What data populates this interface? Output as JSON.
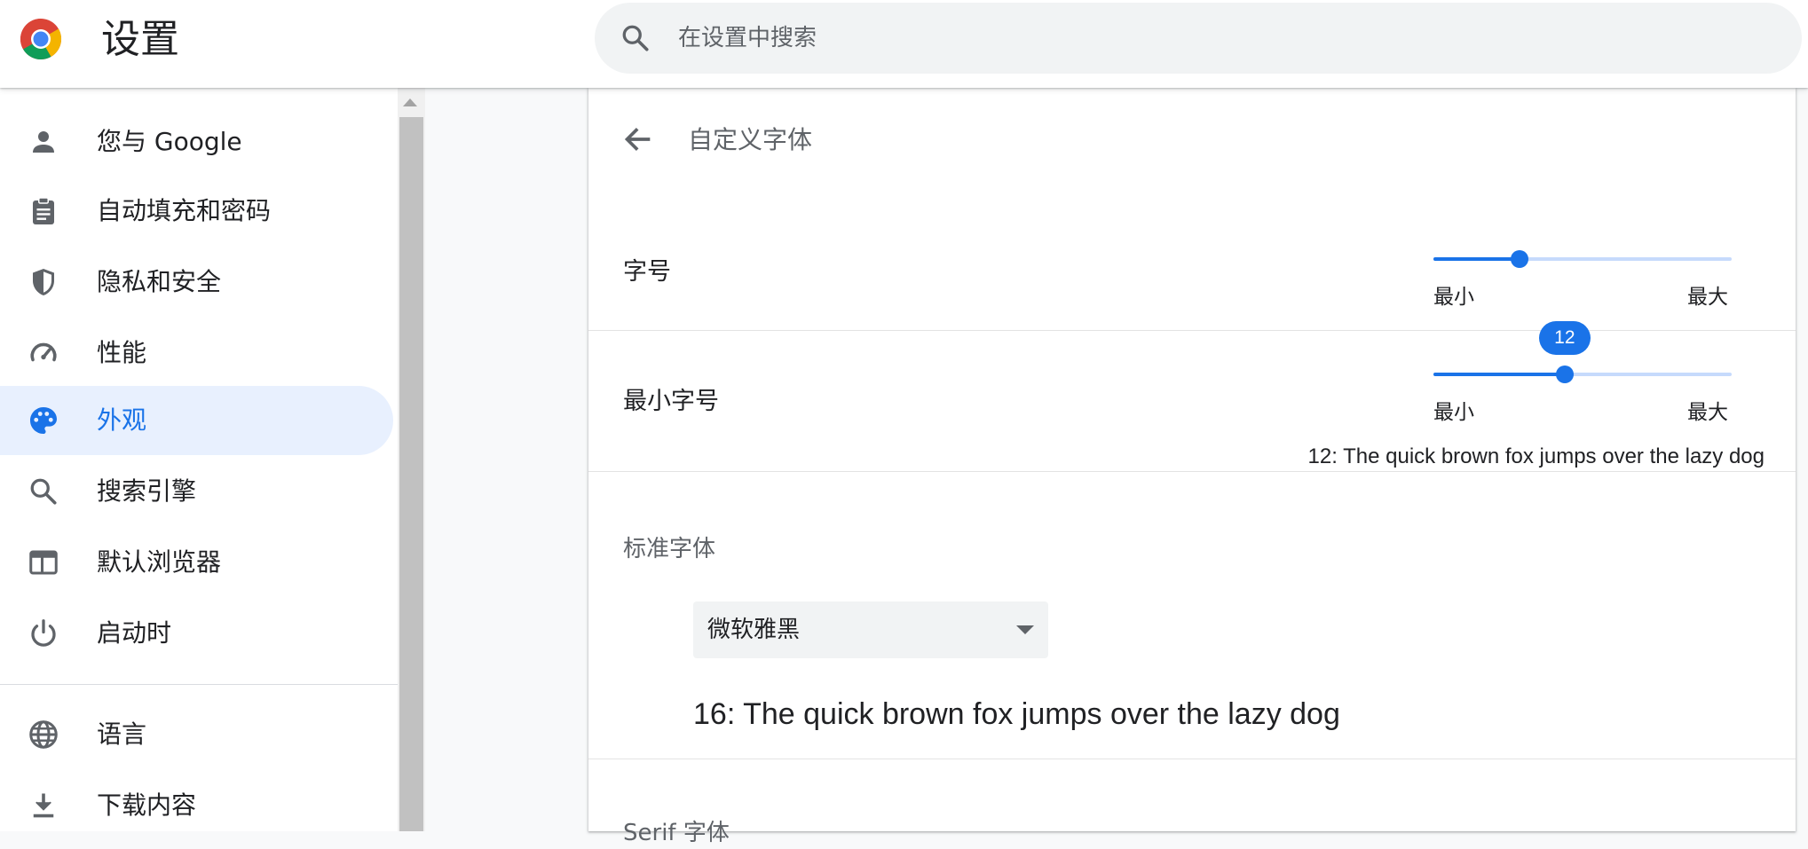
{
  "header": {
    "app_title": "设置",
    "search_placeholder": "在设置中搜索",
    "logo_icon": "chrome-logo",
    "search_icon": "search-icon"
  },
  "sidebar": {
    "items": [
      {
        "label": "您与 Google",
        "icon": "person-icon",
        "active": false
      },
      {
        "label": "自动填充和密码",
        "icon": "clipboard-icon",
        "active": false
      },
      {
        "label": "隐私和安全",
        "icon": "shield-icon",
        "active": false
      },
      {
        "label": "性能",
        "icon": "speedometer-icon",
        "active": false
      },
      {
        "label": "外观",
        "icon": "palette-icon",
        "active": true
      },
      {
        "label": "搜索引擎",
        "icon": "search-icon",
        "active": false
      },
      {
        "label": "默认浏览器",
        "icon": "browser-window-icon",
        "active": false
      },
      {
        "label": "启动时",
        "icon": "power-icon",
        "active": false
      },
      {
        "label": "语言",
        "icon": "globe-icon",
        "active": false
      },
      {
        "label": "下载内容",
        "icon": "download-icon",
        "active": false
      }
    ]
  },
  "main": {
    "page_title": "自定义字体",
    "back_icon": "arrow-back-icon",
    "font_size": {
      "label": "字号",
      "min_label": "最小",
      "max_label": "最大",
      "level_fraction": 0.29
    },
    "min_font_size": {
      "label": "最小字号",
      "min_label": "最小",
      "max_label": "最大",
      "value": "12",
      "level_fraction": 0.44,
      "sample": "12: The quick brown fox jumps over the lazy dog"
    },
    "standard_font": {
      "heading": "标准字体",
      "selected": "微软雅黑",
      "sample": "16: The quick brown fox jumps over the lazy dog"
    },
    "next_section": "Serif 字体"
  },
  "colors": {
    "accent": "#1a73e8",
    "active_bg": "#e8f0fe",
    "track": "#c6dafc"
  }
}
